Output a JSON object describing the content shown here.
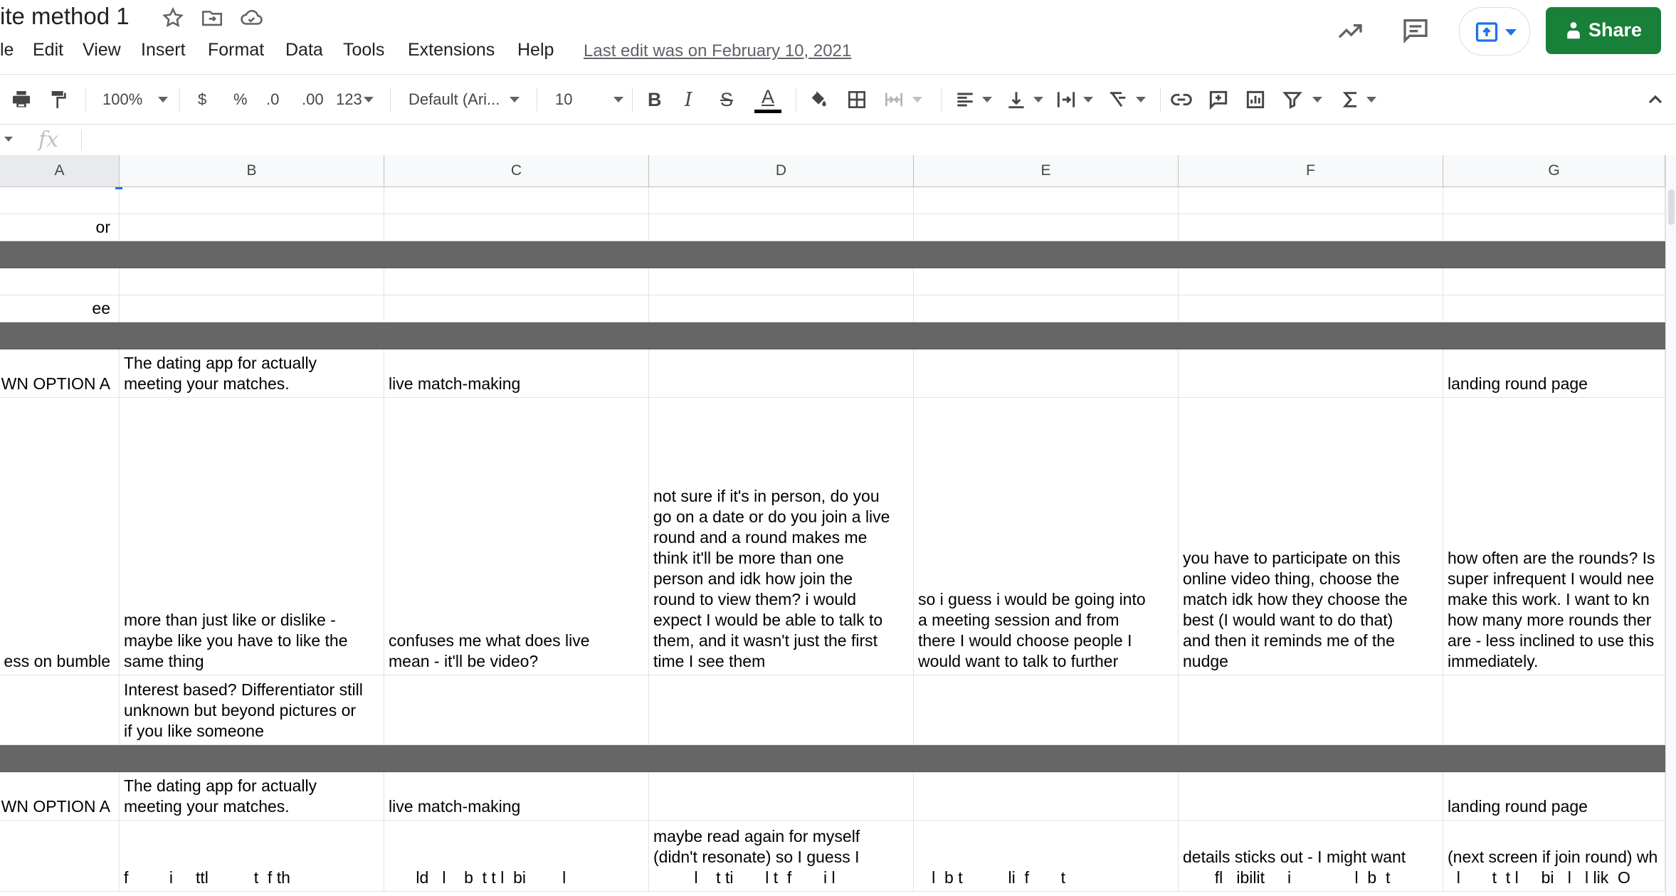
{
  "app": {
    "doc_title": "ite method 1",
    "menu": [
      "le",
      "Edit",
      "View",
      "Insert",
      "Format",
      "Data",
      "Tools",
      "Extensions",
      "Help"
    ],
    "last_edit": "Last edit was on February 10, 2021",
    "share_label": "Share",
    "icons": [
      "star-icon",
      "move-to-folder-icon",
      "cloud-saved-icon",
      "activity-trend-icon",
      "comments-icon",
      "present-icon",
      "lock-person-icon"
    ],
    "accent_color": "#188038",
    "present_color": "#1a73e8"
  },
  "toolbar": {
    "zoom": "100%",
    "currency": "$",
    "percent": "%",
    "decrease_decimal": ".0",
    "increase_decimal": ".00",
    "more_formats": "123",
    "font": "Default (Ari...",
    "font_size": "10",
    "bold": "B",
    "italic": "I",
    "strikethrough": "S",
    "text_color": "A",
    "text_color_bar": "#000000"
  },
  "formula_bar": {
    "fx": "fx",
    "value": ""
  },
  "columns": [
    "A",
    "B",
    "C",
    "D",
    "E",
    "F",
    "G"
  ],
  "rows": [
    {
      "cells": [
        "",
        "",
        "",
        "",
        "",
        "",
        ""
      ]
    },
    {
      "cells": [
        "or",
        "",
        "",
        "",
        "",
        "",
        ""
      ]
    },
    {
      "dark": true,
      "cells": [
        "",
        "",
        "",
        "",
        "",
        "",
        ""
      ]
    },
    {
      "cells": [
        "",
        "",
        "",
        "",
        "",
        "",
        ""
      ]
    },
    {
      "cells": [
        "ee",
        "",
        "",
        "",
        "",
        "",
        ""
      ]
    },
    {
      "dark": true,
      "cells": [
        "",
        "",
        "",
        "",
        "",
        "",
        ""
      ]
    },
    {
      "cells": [
        "WN OPTION A",
        "The dating app for actually\nmeeting your matches.",
        "live match-making",
        "",
        "",
        "",
        "landing round page"
      ]
    },
    {
      "cells": [
        "e A - has used\ng apps -\ness on bumble",
        "more than just like or dislike -\nmaybe like you have to like the\nsame thing",
        "confuses me what does live\nmean - it'll be video?",
        "not sure if it's in person, do you\ngo on a date or do you join a live\nround and a round makes me\nthink it'll be more than one\nperson and idk how join the\nround to view them? i would\nexpect I would be able to talk to\nthem, and it wasn't just the first\ntime I see them",
        "so i guess i would be going into\na meeting session and from\nthere I would choose people I\nwould want to talk to further",
        "you have to participate on this\nonline video thing, choose the\nmatch idk how they choose the\nbest (I would want to do that)\nand then it reminds me of the\nnudge",
        "how often are the rounds? Is\nsuper infrequent I would nee\nmake this work. I want to kn\nhow many more rounds ther\nare - less inclined to use this\nimmediately."
      ]
    },
    {
      "cells": [
        "",
        "Interest based? Differentiator still\nunknown but beyond pictures or\nif you like someone",
        "",
        "",
        "",
        "",
        ""
      ]
    },
    {
      "dark": true,
      "cells": [
        "",
        "",
        "",
        "",
        "",
        "",
        ""
      ]
    },
    {
      "cells": [
        "WN OPTION A",
        "The dating app for actually\nmeeting your matches.",
        "live match-making",
        "",
        "",
        "",
        "landing round page"
      ]
    },
    {
      "cells": [
        "",
        "f         i     ttl          t  f th",
        "      ld   l    b  t t l  bi        l",
        "maybe read again for myself\n(didn't resonate) so I guess I\n         l    t ti       l t  f       i l",
        "   l  b t          li  f       t",
        "details sticks out - I might want\n       fl   ibilit     i              l  b  t",
        "(next screen if join round) wh\n  l       t  t l     bi   l   l lik  O"
      ]
    }
  ]
}
